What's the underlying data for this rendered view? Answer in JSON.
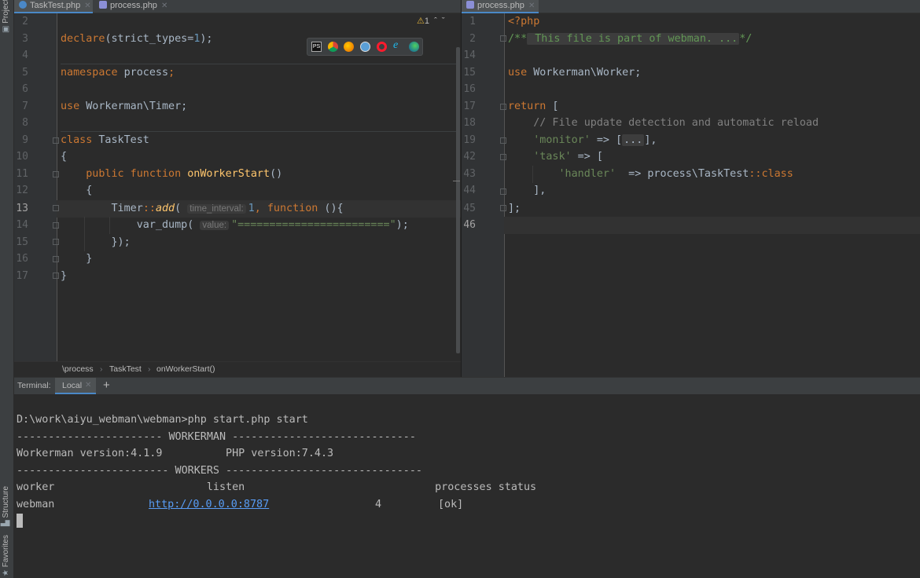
{
  "sidebar": {
    "project": "Project",
    "structure": "Structure",
    "favorites": "Favorites"
  },
  "tabs_left": [
    {
      "label": "TaskTest.php",
      "active": true
    },
    {
      "label": "process.php",
      "active": false
    }
  ],
  "tabs_right": [
    {
      "label": "process.php",
      "active": true
    }
  ],
  "inspection": {
    "warning_count": "1",
    "warning_icon": "warning-icon"
  },
  "browser_icons": [
    "phpstorm-icon",
    "chrome-icon",
    "firefox-icon",
    "safari-icon",
    "opera-icon",
    "ie-icon",
    "edge-icon"
  ],
  "left_editor": {
    "current_line": "13",
    "lines": [
      {
        "n": "2",
        "code": ""
      },
      {
        "n": "3",
        "code": "declare(strict_types=1);"
      },
      {
        "n": "4",
        "code": ""
      },
      {
        "n": "5",
        "code": "namespace process;"
      },
      {
        "n": "6",
        "code": ""
      },
      {
        "n": "7",
        "code": "use Workerman\\Timer;"
      },
      {
        "n": "8",
        "code": ""
      },
      {
        "n": "9",
        "code": "class TaskTest"
      },
      {
        "n": "10",
        "code": "{"
      },
      {
        "n": "11",
        "code": "    public function onWorkerStart()"
      },
      {
        "n": "12",
        "code": "    {"
      },
      {
        "n": "13",
        "code": "        Timer::add( time_interval: 1, function (){"
      },
      {
        "n": "14",
        "code": "            var_dump( value: \"========================\");"
      },
      {
        "n": "15",
        "code": "        });"
      },
      {
        "n": "16",
        "code": "    }"
      },
      {
        "n": "17",
        "code": "}"
      }
    ],
    "tokens": {
      "declare": "declare",
      "strict_types": "(strict_types=",
      "one": "1",
      "close_semi": ");",
      "namespace_kw": "namespace",
      "namespace_name": " process",
      "semi": ";",
      "use_kw": "use",
      "use_name": " Workerman\\Timer;",
      "class_kw": "class",
      "class_name": " TaskTest",
      "brace_open": "{",
      "brace_close": "}",
      "public_kw": "public",
      "function_kw": " function",
      "method_name": " onWorkerStart",
      "parens": "()",
      "timer": "Timer",
      "colons": "::",
      "add": "add",
      "paren_open": "( ",
      "hint_time": "time_interval:",
      "comma": ", ",
      "function_kw2": "function",
      "closure_tail": " (){",
      "var_dump": "var_dump",
      "hint_value": "value:",
      "dump_str": "\"========================\"",
      "dump_tail": ");",
      "closure_close": "});"
    }
  },
  "right_editor": {
    "current_line": "46",
    "lines": [
      {
        "n": "1",
        "code": "<?php"
      },
      {
        "n": "2",
        "code": "/** This file is part of webman. ...*/"
      },
      {
        "n": "14",
        "code": ""
      },
      {
        "n": "15",
        "code": "use Workerman\\Worker;"
      },
      {
        "n": "16",
        "code": ""
      },
      {
        "n": "17",
        "code": "return ["
      },
      {
        "n": "18",
        "code": "    // File update detection and automatic reload"
      },
      {
        "n": "19",
        "code": "    'monitor' => [...],"
      },
      {
        "n": "42",
        "code": "    'task' => ["
      },
      {
        "n": "43",
        "code": "        'handler'  => process\\TaskTest::class"
      },
      {
        "n": "44",
        "code": "    ],"
      },
      {
        "n": "45",
        "code": "];"
      },
      {
        "n": "46",
        "code": ""
      }
    ],
    "tokens": {
      "php_open": "<?php",
      "doc_open": "/**",
      "doc_fold": " This file is part of webman. ...",
      "doc_close": "*/",
      "use_kw": "use",
      "use_name": " Workerman\\Worker;",
      "return_kw": "return",
      "bracket_open": " [",
      "comment": "// File update detection and automatic reload",
      "monitor_key": "'monitor'",
      "arrow": " => ",
      "monitor_open": "[",
      "monitor_fold": "...",
      "monitor_close": "],",
      "task_key": "'task'",
      "task_arrow": " => [",
      "handler_key": "'handler'",
      "handler_arrow": "  => process\\TaskTest",
      "handler_colons": "::",
      "class_kw": "class",
      "inner_close": "],",
      "outer_close": "];"
    }
  },
  "breadcrumb": [
    "\\process",
    "TaskTest",
    "onWorkerStart()"
  ],
  "terminal": {
    "label": "Terminal:",
    "tab": "Local",
    "add": "+",
    "lines": [
      "D:\\work\\aiyu_webman\\webman>php start.php start",
      "----------------------- WORKERMAN -----------------------------",
      "Workerman version:4.1.9          PHP version:7.4.3",
      "------------------------ WORKERS -------------------------------",
      "worker                        listen                              processes status"
    ],
    "worker_row": {
      "name": "webman",
      "listen": "http://0.0.0.0:8787",
      "processes": "4",
      "status": "[ok]"
    }
  },
  "colors": {
    "background": "#2b2b2b",
    "gutter": "#313335",
    "keyword": "#cc7832",
    "string": "#6a8759",
    "number": "#6897bb",
    "function": "#ffc66d",
    "link": "#589df6"
  }
}
